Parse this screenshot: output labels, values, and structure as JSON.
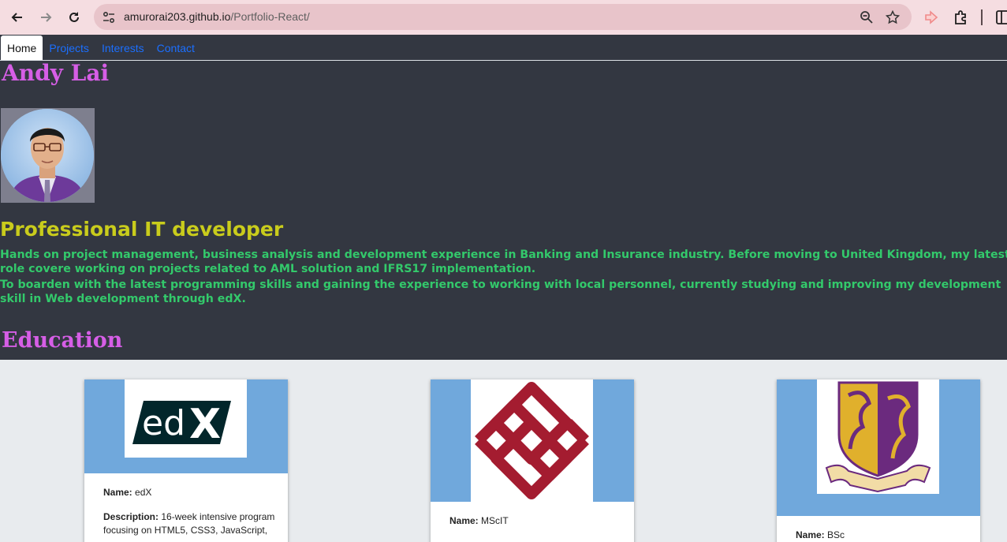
{
  "browser": {
    "url_host": "amurorai203.github.io",
    "url_path": "/Portfolio-React/"
  },
  "nav": {
    "tabs": [
      {
        "label": "Home",
        "active": true
      },
      {
        "label": "Projects",
        "active": false
      },
      {
        "label": "Interests",
        "active": false
      },
      {
        "label": "Contact",
        "active": false
      }
    ]
  },
  "profile": {
    "name": "Andy Lai",
    "headline": "Professional IT developer",
    "bio_1": "Hands on project management, business analysis and development experience in Banking and Insurance industry. Before moving to United Kingdom, my latest role covere working on projects related to AML solution and IFRS17 implementation.",
    "bio_2": "To boarden with the latest programming skills and gaining the experience to working with local personnel, currently studying and improving my development skill in Web development through edX."
  },
  "education": {
    "title": "Education",
    "name_label": "Name:",
    "description_label": "Description:",
    "cards": [
      {
        "name": "edX",
        "logo": "edx-logo",
        "description": "16-week intensive program focusing on HTML5, CSS3, JavaScript,"
      },
      {
        "name": "MScIT",
        "logo": "polyu-logo"
      },
      {
        "name": "BSc",
        "logo": "cuhk-logo"
      }
    ]
  },
  "colors": {
    "hero_bg": "#333741",
    "name_color": "#d65ee6",
    "headline_color": "#c9cc1c",
    "bio_color": "#33c96b",
    "card_head": "#70a8dc",
    "tab_link": "#1b6fff"
  }
}
